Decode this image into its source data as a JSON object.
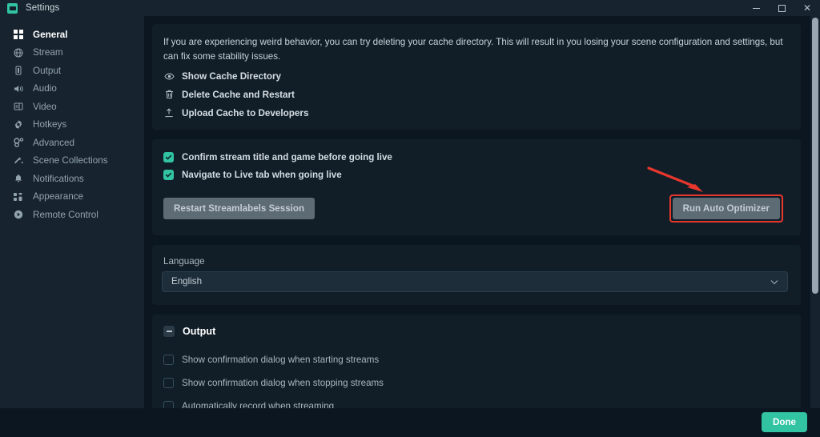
{
  "window": {
    "title": "Settings",
    "app_icon": "settings-app-icon",
    "controls": {
      "minimize": "minimize-icon",
      "maximize": "maximize-icon",
      "close": "close-icon"
    }
  },
  "sidebar": {
    "items": [
      {
        "label": "General",
        "icon": "grid-icon",
        "active": true
      },
      {
        "label": "Stream",
        "icon": "globe-icon",
        "active": false
      },
      {
        "label": "Output",
        "icon": "output-icon",
        "active": false
      },
      {
        "label": "Audio",
        "icon": "speaker-icon",
        "active": false
      },
      {
        "label": "Video",
        "icon": "monitor-icon",
        "active": false
      },
      {
        "label": "Hotkeys",
        "icon": "gear-icon",
        "active": false
      },
      {
        "label": "Advanced",
        "icon": "sliders-icon",
        "active": false
      },
      {
        "label": "Scene Collections",
        "icon": "scenes-icon",
        "active": false
      },
      {
        "label": "Notifications",
        "icon": "bell-icon",
        "active": false
      },
      {
        "label": "Appearance",
        "icon": "appearance-icon",
        "active": false
      },
      {
        "label": "Remote Control",
        "icon": "remote-icon",
        "active": false
      }
    ]
  },
  "cache_panel": {
    "description": "If you are experiencing weird behavior, you can try deleting your cache directory. This will result in you losing your scene configuration and settings, but can fix some stability issues.",
    "actions": [
      {
        "label": "Show Cache Directory",
        "icon": "eye-icon"
      },
      {
        "label": "Delete Cache and Restart",
        "icon": "trash-icon"
      },
      {
        "label": "Upload Cache to Developers",
        "icon": "upload-icon"
      }
    ]
  },
  "stream_panel": {
    "checkboxes": [
      {
        "label": "Confirm stream title and game before going live",
        "checked": true
      },
      {
        "label": "Navigate to Live tab when going live",
        "checked": true
      }
    ],
    "restart_button": "Restart Streamlabels Session",
    "optimizer_button": "Run Auto Optimizer"
  },
  "language_panel": {
    "label": "Language",
    "selected": "English",
    "chevron": "chevron-down-icon"
  },
  "output_panel": {
    "title": "Output",
    "collapse_icon": "minus-icon",
    "checkboxes": [
      {
        "label": "Show confirmation dialog when starting streams",
        "checked": false
      },
      {
        "label": "Show confirmation dialog when stopping streams",
        "checked": false
      },
      {
        "label": "Automatically record when streaming",
        "checked": false
      }
    ]
  },
  "footer": {
    "done_label": "Done"
  },
  "annotation": {
    "type": "red-arrow",
    "color": "#e8372c",
    "points_to": "Run Auto Optimizer"
  }
}
